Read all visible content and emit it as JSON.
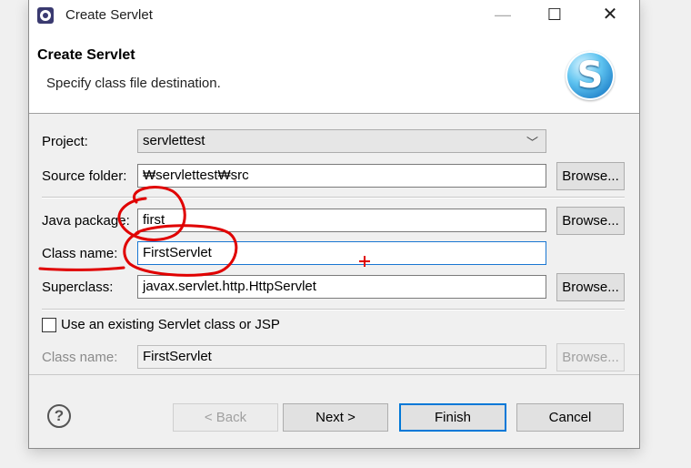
{
  "window": {
    "title": "Create Servlet"
  },
  "header": {
    "title": "Create Servlet",
    "description": "Specify class file destination.",
    "logo_letter": "S"
  },
  "form": {
    "project": {
      "label": "Project:",
      "value": "servlettest"
    },
    "source_folder": {
      "label": "Source folder:",
      "value": "₩servlettest₩src"
    },
    "java_package": {
      "label": "Java package:",
      "value": "first"
    },
    "class_name": {
      "label": "Class name:",
      "value": "FirstServlet"
    },
    "superclass": {
      "label": "Superclass:",
      "value": "javax.servlet.http.HttpServlet"
    },
    "use_existing": {
      "label": "Use an existing Servlet class or JSP",
      "checked": false
    },
    "existing_class_name": {
      "label": "Class name:",
      "value": "FirstServlet"
    },
    "browse_label": "Browse..."
  },
  "buttons": {
    "back": "< Back",
    "next": "Next >",
    "finish": "Finish",
    "cancel": "Cancel",
    "help": "?"
  },
  "colors": {
    "annotation": "#e00000",
    "focus_border": "#1976d2",
    "default_button_border": "#0078d7"
  }
}
